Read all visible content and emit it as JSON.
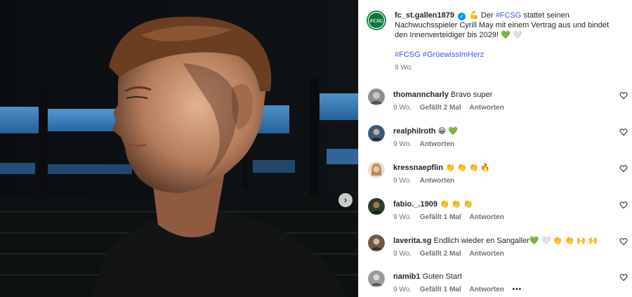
{
  "post": {
    "username": "fc_st.gallen1879",
    "verified_icon": "verified-check-icon",
    "emoji_flex": "💪",
    "caption_pre": "Der",
    "hashtag_main": "#FCSG",
    "caption_post": "stattet seinen Nachwuchsspieler Cyrill May mit einem Vertrag aus und bindet den Innenverteidiger bis 2029!",
    "emoji_hearts": "💚 🤍",
    "hashtags": [
      "#FCSG",
      "#GrüewissImHerz"
    ],
    "time": "9 Wo.",
    "logo_text": "FCSG",
    "brand_color": "#0a7a3c"
  },
  "comments": [
    {
      "user": "thomanncharly",
      "text": "Bravo super",
      "time": "9 Wo.",
      "likes": "Gefällt 2 Mal",
      "reply": "Antworten",
      "avatar_color": "#8a8f94"
    },
    {
      "user": "realphilroth",
      "text": "😁 💚",
      "time": "9 Wo.",
      "likes": "",
      "reply": "Antworten",
      "avatar_color": "#3a5a7a"
    },
    {
      "user": "kressnaepflin",
      "text": "👏 👏 👏 🔥",
      "time": "9 Wo.",
      "likes": "",
      "reply": "Antworten",
      "avatar_color": "#c7a27a"
    },
    {
      "user": "fabio._.1909",
      "text": "👏 👏 👏",
      "time": "9 Wo.",
      "likes": "Gefällt 1 Mal",
      "reply": "Antworten",
      "avatar_color": "#2f3b2c"
    },
    {
      "user": "laverita.sg",
      "text": "Endlich wieder en Sangaller💚 🤍 👏 👏 🙌 🙌",
      "time": "9 Wo.",
      "likes": "Gefällt 2 Mal",
      "reply": "Antworten",
      "avatar_color": "#6b5a48"
    },
    {
      "user": "namib1",
      "text": "Guten Start",
      "time": "9 Wo.",
      "likes": "Gefällt 1 Mal",
      "reply": "Antworten",
      "avatar_color": "#9a9a9a",
      "more": "•••"
    }
  ],
  "icons": {
    "next": "chevron-right-icon",
    "heart": "heart-outline-icon"
  }
}
